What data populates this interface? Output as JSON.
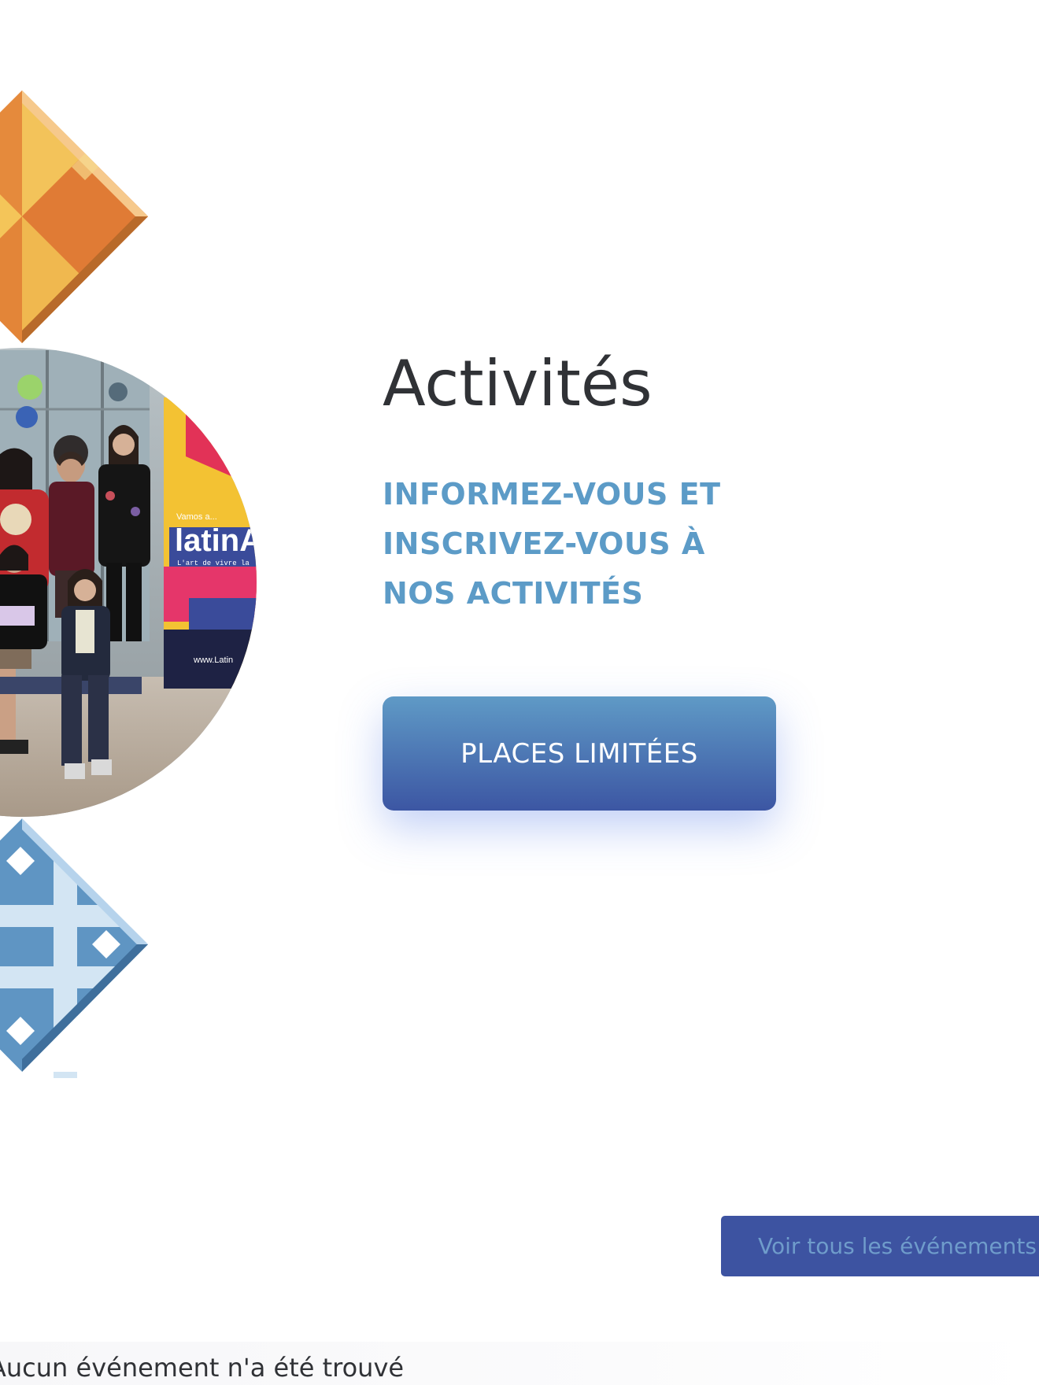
{
  "activities": {
    "title": "Activités",
    "subtitle_lines": [
      "INFORMEZ-VOUS ET",
      "INSCRIVEZ-VOUS À",
      "NOS ACTIVITÉS"
    ],
    "cta_label": "PLACES LIMITÉES"
  },
  "photo": {
    "banner_small": "Vamos a...",
    "banner_brand": "latinArt",
    "banner_tagline": "L'art de vivre la",
    "banner_url": "www.Latin"
  },
  "events": {
    "view_all_label": "Voir tous les événements",
    "empty_message": "Aucun événement n'a été trouvé"
  },
  "colors": {
    "title": "#303236",
    "subtitle": "#5c9bc7",
    "button_top": "#5f9ac6",
    "button_bottom": "#3c56a3",
    "events_button_bg": "#3d53a1",
    "events_button_text": "#6f9ccb"
  }
}
